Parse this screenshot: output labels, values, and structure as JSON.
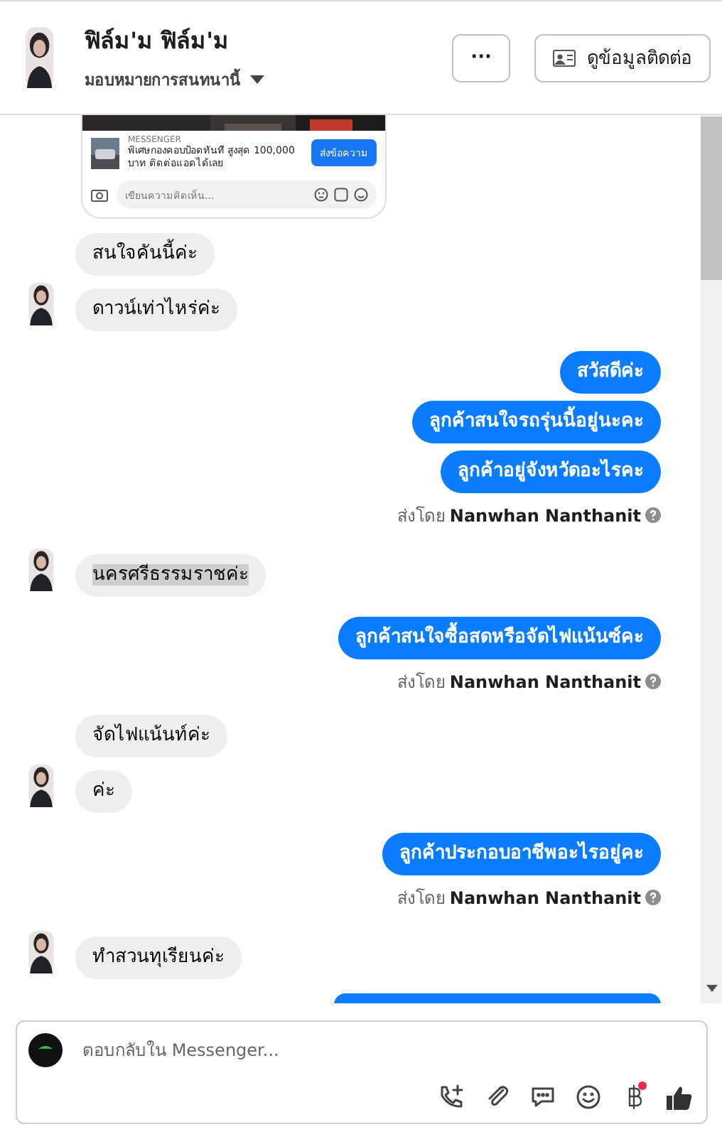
{
  "header": {
    "name": "ฟิล์ม'ม ฟิล์ม'ม",
    "assign_label": "มอบหมายการสนทนานี้",
    "more_button": "···",
    "contact_button": "ดูข้อมูลติดต่อ"
  },
  "ad_preview": {
    "source": "MESSENGER",
    "headline": "พิเศษกองคอบป้อดทันที สูงสุด 100,000 บาท ติดต่อแอดได้เลย",
    "cta": "ส่งข้อความ",
    "comment_placeholder": "เขียนความคิดเห็น..."
  },
  "messages": [
    {
      "kind": "incoming",
      "text": "สนใจคันนี้ค่ะ",
      "avatar": false,
      "selected": false
    },
    {
      "kind": "incoming",
      "text": "ดาวน์เท่าไหร่ค่ะ",
      "avatar": true,
      "selected": false
    },
    {
      "kind": "outgoing",
      "text": "สวัสดีค่ะ"
    },
    {
      "kind": "outgoing",
      "text": "ลูกค้าสนใจรถรุ่นนี้อยู่นะคะ"
    },
    {
      "kind": "outgoing",
      "text": "ลูกค้าอยู่จังหวัดอะไรคะ"
    },
    {
      "kind": "sent_by",
      "prefix": "ส่งโดย",
      "author": "Nanwhan Nanthanit"
    },
    {
      "kind": "incoming",
      "text": "นครศรีธรรมราชค่ะ",
      "avatar": true,
      "selected": true
    },
    {
      "kind": "outgoing",
      "text": "ลูกค้าสนใจซื้อสดหรือจัดไฟแน้นซ์คะ"
    },
    {
      "kind": "sent_by",
      "prefix": "ส่งโดย",
      "author": "Nanwhan Nanthanit"
    },
    {
      "kind": "incoming",
      "text": "จัดไฟแน้นท์ค่ะ",
      "avatar": false,
      "selected": false
    },
    {
      "kind": "incoming",
      "text": "ค่ะ",
      "avatar": true,
      "selected": false
    },
    {
      "kind": "outgoing",
      "text": "ลูกค้าประกอบอาชีพอะไรอยู่คะ"
    },
    {
      "kind": "sent_by",
      "prefix": "ส่งโดย",
      "author": "Nanwhan Nanthanit"
    },
    {
      "kind": "incoming",
      "text": "ทำสวนทุเรียนค่ะ",
      "avatar": true,
      "selected": false
    },
    {
      "kind": "outgoing_clipped"
    }
  ],
  "composer": {
    "placeholder": "ตอบกลับใน Messenger...",
    "payment_badge": true
  }
}
